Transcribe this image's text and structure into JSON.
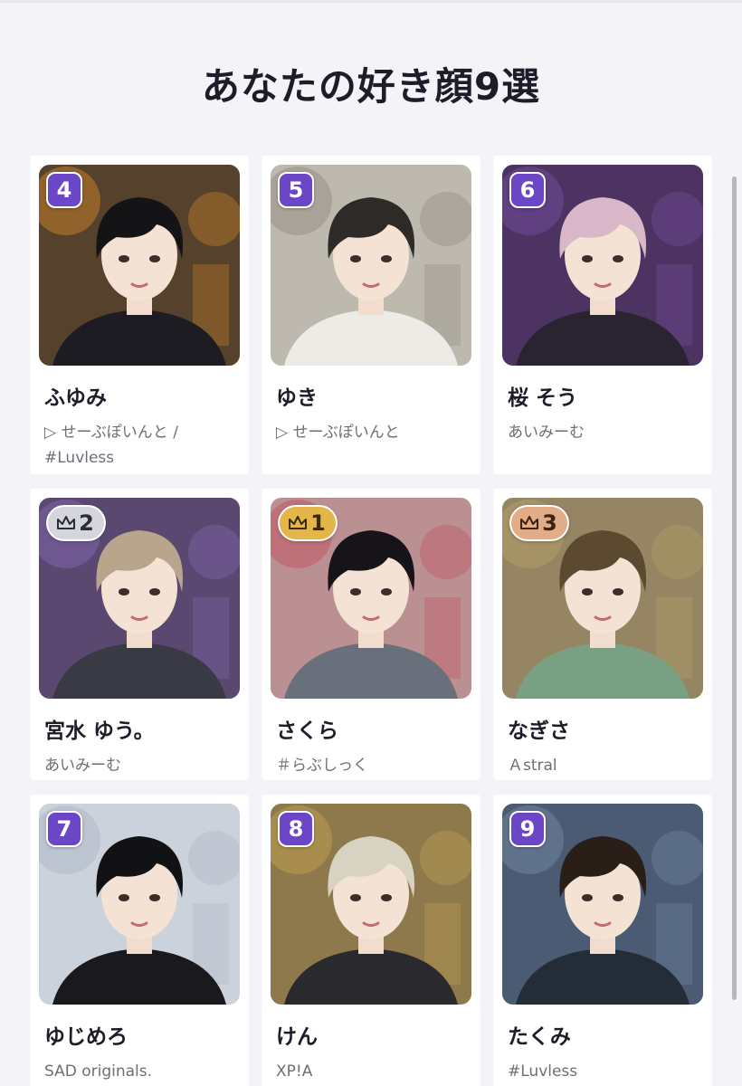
{
  "page": {
    "title": "あなたの好き顔9選"
  },
  "cards": [
    {
      "rank": "4",
      "medal": "",
      "name": "ふゆみ",
      "group": "▷ せーぶぽいんと / #Luvless",
      "bg": "#2b2a2c",
      "accent": "#d98a2a",
      "hair": "#141416",
      "cloth": "#1c1c22"
    },
    {
      "rank": "5",
      "medal": "",
      "name": "ゆき",
      "group": "▷ せーぶぽいんと",
      "bg": "#cfcac0",
      "accent": "#8d877d",
      "hair": "#2e2a28",
      "cloth": "#ecebe6"
    },
    {
      "rank": "6",
      "medal": "",
      "name": "桜 そう",
      "group": "あいみーむ",
      "bg": "#3c2a4a",
      "accent": "#7a4fa8",
      "hair": "#d9b6c8",
      "cloth": "#2a2430"
    },
    {
      "rank": "2",
      "medal": "silver",
      "name": "宮水 ゆう。",
      "group": "あいみーむ",
      "bg": "#4a3c5a",
      "accent": "#8a6cb8",
      "hair": "#b9a58c",
      "cloth": "#3a3a44"
    },
    {
      "rank": "1",
      "medal": "gold",
      "name": "さくら",
      "group": "＃らぶしっく",
      "bg": "#b8a7a4",
      "accent": "#c44b5a",
      "hair": "#161418",
      "cloth": "#6a6f7c"
    },
    {
      "rank": "3",
      "medal": "bronze",
      "name": "なぎさ",
      "group": "Ａstral",
      "bg": "#8a7b62",
      "accent": "#b8a468",
      "hair": "#5c4a30",
      "cloth": "#7aa084"
    },
    {
      "rank": "7",
      "medal": "",
      "name": "ゆじめろ",
      "group": "SAD originals.",
      "bg": "#d9dde4",
      "accent": "#a9b4c4",
      "hair": "#121214",
      "cloth": "#1a1a1e"
    },
    {
      "rank": "8",
      "medal": "",
      "name": "けん",
      "group": "XP!A",
      "bg": "#7a6a4a",
      "accent": "#c9a654",
      "hair": "#d8d2c2",
      "cloth": "#2a2a2e"
    },
    {
      "rank": "9",
      "medal": "",
      "name": "たくみ",
      "group": "#Luvless",
      "bg": "#3a4a62",
      "accent": "#7c8ea8",
      "hair": "#2a1e18",
      "cloth": "#242c38"
    }
  ]
}
